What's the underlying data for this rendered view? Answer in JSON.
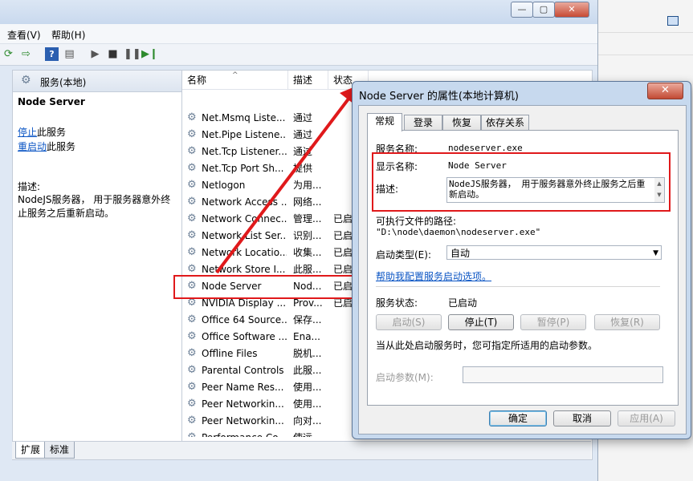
{
  "menu": {
    "view": "查看(V)",
    "help": "帮助(H)"
  },
  "left_pane": {
    "header": "服务(本地)",
    "service_title": "Node Server",
    "stop_link": "停止",
    "stop_suffix": "此服务",
    "restart_link": "重启动",
    "restart_suffix": "此服务",
    "desc_label": "描述:",
    "desc_text": "NodeJS服务器， 用于服务器意外终止服务之后重新启动。"
  },
  "columns": {
    "name": "名称",
    "desc": "描述",
    "status": "状态"
  },
  "services": [
    {
      "name": "Net.Msmq Liste...",
      "desc": "通过",
      "status": ""
    },
    {
      "name": "Net.Pipe Listene...",
      "desc": "通过",
      "status": ""
    },
    {
      "name": "Net.Tcp Listener...",
      "desc": "通过",
      "status": ""
    },
    {
      "name": "Net.Tcp Port Sh...",
      "desc": "提供",
      "status": ""
    },
    {
      "name": "Netlogon",
      "desc": "为用...",
      "status": ""
    },
    {
      "name": "Network Access ...",
      "desc": "网络...",
      "status": ""
    },
    {
      "name": "Network Connec...",
      "desc": "管理...",
      "status": "已启"
    },
    {
      "name": "Network List Ser...",
      "desc": "识别...",
      "status": "已启"
    },
    {
      "name": "Network Locatio...",
      "desc": "收集...",
      "status": "已启"
    },
    {
      "name": "Network Store I...",
      "desc": "此服...",
      "status": "已启"
    },
    {
      "name": "Node Server",
      "desc": "Nod...",
      "status": "已启"
    },
    {
      "name": "NVIDIA Display ...",
      "desc": "Prov...",
      "status": "已启"
    },
    {
      "name": "Office 64 Source...",
      "desc": "保存...",
      "status": ""
    },
    {
      "name": "Office Software ...",
      "desc": "Ena...",
      "status": ""
    },
    {
      "name": "Offline Files",
      "desc": "脱机...",
      "status": ""
    },
    {
      "name": "Parental Controls",
      "desc": "此服...",
      "status": ""
    },
    {
      "name": "Peer Name Res...",
      "desc": "使用...",
      "status": ""
    },
    {
      "name": "Peer Networkin...",
      "desc": "使用...",
      "status": ""
    },
    {
      "name": "Peer Networkin...",
      "desc": "向对...",
      "status": ""
    },
    {
      "name": "Performance Co...",
      "desc": "使远...",
      "status": ""
    }
  ],
  "bottom_tabs": {
    "extended": "扩展",
    "standard": "标准"
  },
  "dialog": {
    "title": "Node Server 的属性(本地计算机)",
    "tabs": [
      "常规",
      "登录",
      "恢复",
      "依存关系"
    ],
    "service_name_label": "服务名称:",
    "service_name_value": "nodeserver.exe",
    "display_name_label": "显示名称:",
    "display_name_value": "Node Server",
    "description_label": "描述:",
    "description_value": "NodeJS服务器， 用于服务器意外终止服务之后重新启动。",
    "exe_path_label": "可执行文件的路径:",
    "exe_path_value": "\"D:\\node\\daemon\\nodeserver.exe\"",
    "startup_type_label": "启动类型(E):",
    "startup_type_value": "自动",
    "help_link": "帮助我配置服务启动选项。",
    "status_label": "服务状态:",
    "status_value": "已启动",
    "start_btn": "启动(S)",
    "stop_btn": "停止(T)",
    "pause_btn": "暂停(P)",
    "resume_btn": "恢复(R)",
    "start_params_hint": "当从此处启动服务时，您可指定所适用的启动参数。",
    "start_params_label": "启动参数(M):",
    "start_params_value": "",
    "ok_btn": "确定",
    "cancel_btn": "取消",
    "apply_btn": "应用(A)"
  },
  "colors": {
    "annotation_red": "#e0191b",
    "link_blue": "#0b55c4"
  }
}
